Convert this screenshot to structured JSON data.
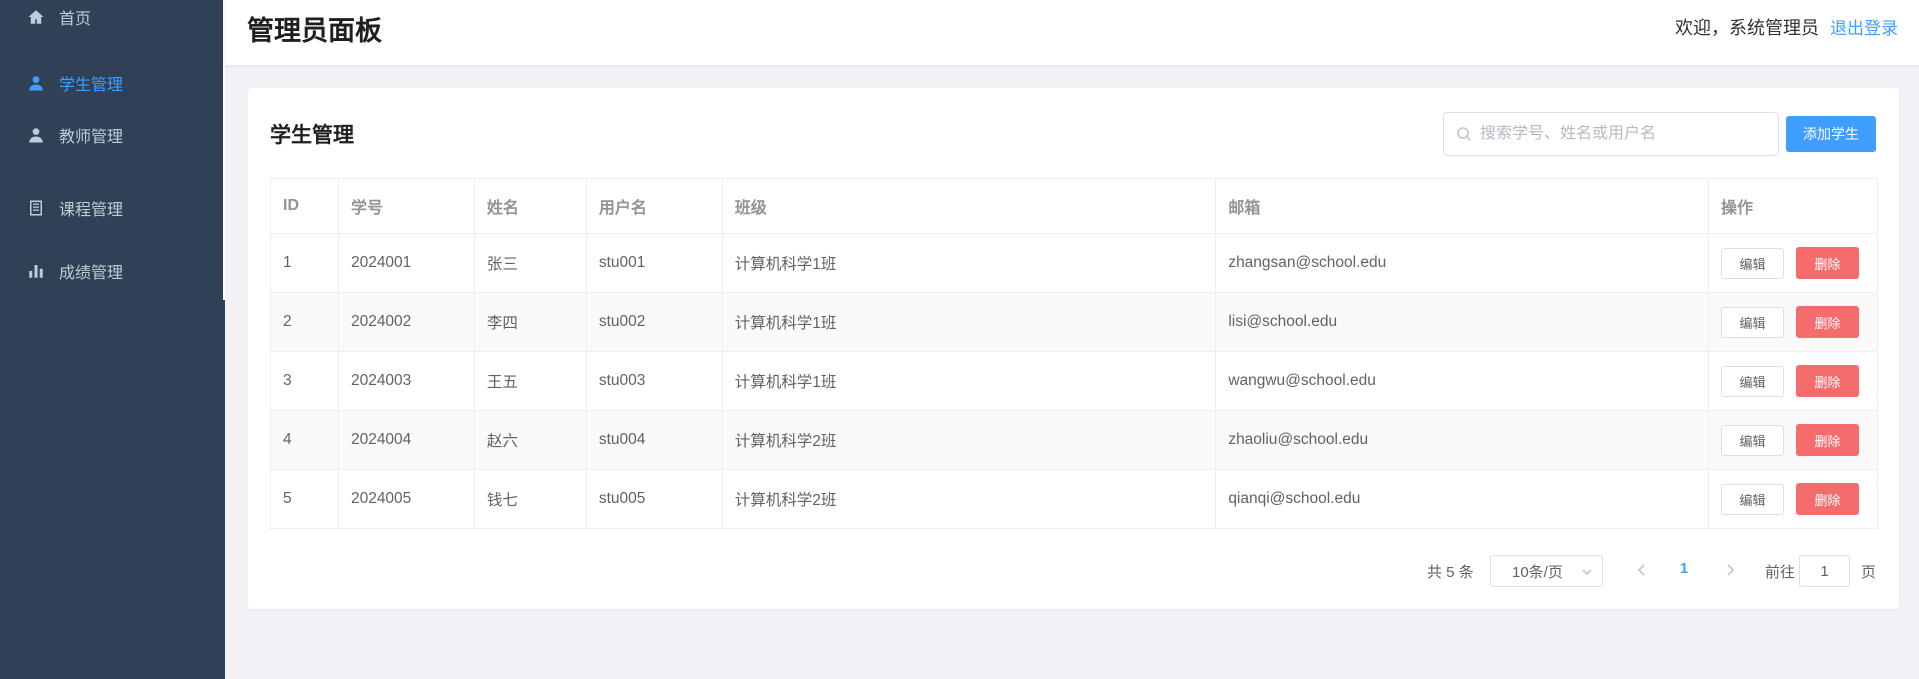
{
  "sidebar": {
    "items": [
      {
        "label": "首页",
        "icon": "home-icon",
        "active": false
      },
      {
        "label": "学生管理",
        "icon": "user-icon",
        "active": true
      },
      {
        "label": "教师管理",
        "icon": "user-icon",
        "active": false
      },
      {
        "label": "课程管理",
        "icon": "document-icon",
        "active": false
      },
      {
        "label": "成绩管理",
        "icon": "bar-chart-icon",
        "active": false
      }
    ]
  },
  "header": {
    "title": "管理员面板",
    "welcome": "欢迎，系统管理员",
    "logout": "退出登录"
  },
  "main": {
    "title": "学生管理",
    "search": {
      "placeholder": "搜索学号、姓名或用户名",
      "value": ""
    },
    "add_button": "添加学生",
    "table": {
      "columns": [
        "ID",
        "学号",
        "姓名",
        "用户名",
        "班级",
        "邮箱",
        "操作"
      ],
      "rows": [
        {
          "id": "1",
          "student_no": "2024001",
          "name": "张三",
          "username": "stu001",
          "class": "计算机科学1班",
          "email": "zhangsan@school.edu"
        },
        {
          "id": "2",
          "student_no": "2024002",
          "name": "李四",
          "username": "stu002",
          "class": "计算机科学1班",
          "email": "lisi@school.edu"
        },
        {
          "id": "3",
          "student_no": "2024003",
          "name": "王五",
          "username": "stu003",
          "class": "计算机科学1班",
          "email": "wangwu@school.edu"
        },
        {
          "id": "4",
          "student_no": "2024004",
          "name": "赵六",
          "username": "stu004",
          "class": "计算机科学2班",
          "email": "zhaoliu@school.edu"
        },
        {
          "id": "5",
          "student_no": "2024005",
          "name": "钱七",
          "username": "stu005",
          "class": "计算机科学2班",
          "email": "qianqi@school.edu"
        }
      ],
      "edit_label": "编辑",
      "delete_label": "删除"
    },
    "pagination": {
      "total": "共 5 条",
      "page_size": "10条/页",
      "current_page": "1",
      "goto_label": "前往",
      "goto_value": "1",
      "goto_suffix": "页"
    }
  },
  "colors": {
    "sidebar_bg": "#304156",
    "accent": "#409eff",
    "danger": "#f56c6c"
  }
}
